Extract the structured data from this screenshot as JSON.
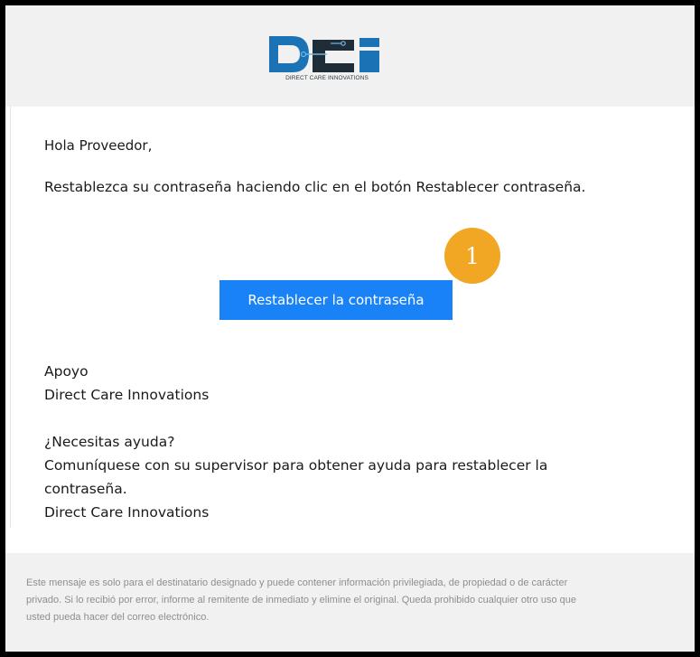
{
  "header": {
    "logo_caption": "DIRECT CARE INNOVATIONS"
  },
  "email": {
    "greeting": "Hola Proveedor,",
    "instruction": "Restablezca su contraseña haciendo clic en el botón Restablecer contraseña.",
    "reset_button_label": "Restablecer la contraseña",
    "callout_number": "1",
    "signature_line1": "Apoyo",
    "signature_line2": "Direct Care Innovations",
    "help_heading": "¿Necesitas ayuda?",
    "help_text_line1": "Comuníquese con su supervisor para obtener ayuda para restablecer la",
    "help_text_line2": "contraseña.",
    "help_signature": "Direct Care Innovations"
  },
  "footer": {
    "disclaimer_line1": "Este mensaje es solo para el destinatario designado y puede contener información privilegiada, de propiedad o de carácter",
    "disclaimer_line2": "privado. Si lo recibió por error, informe al remitente de inmediato y elimine el original. Queda prohibido cualquier otro uso que",
    "disclaimer_line3": "usted pueda hacer del correo electrónico."
  },
  "colors": {
    "button": "#1a82f7",
    "callout": "#f1a624",
    "logo_blue": "#1b73b5",
    "logo_dark": "#1f2d38"
  }
}
